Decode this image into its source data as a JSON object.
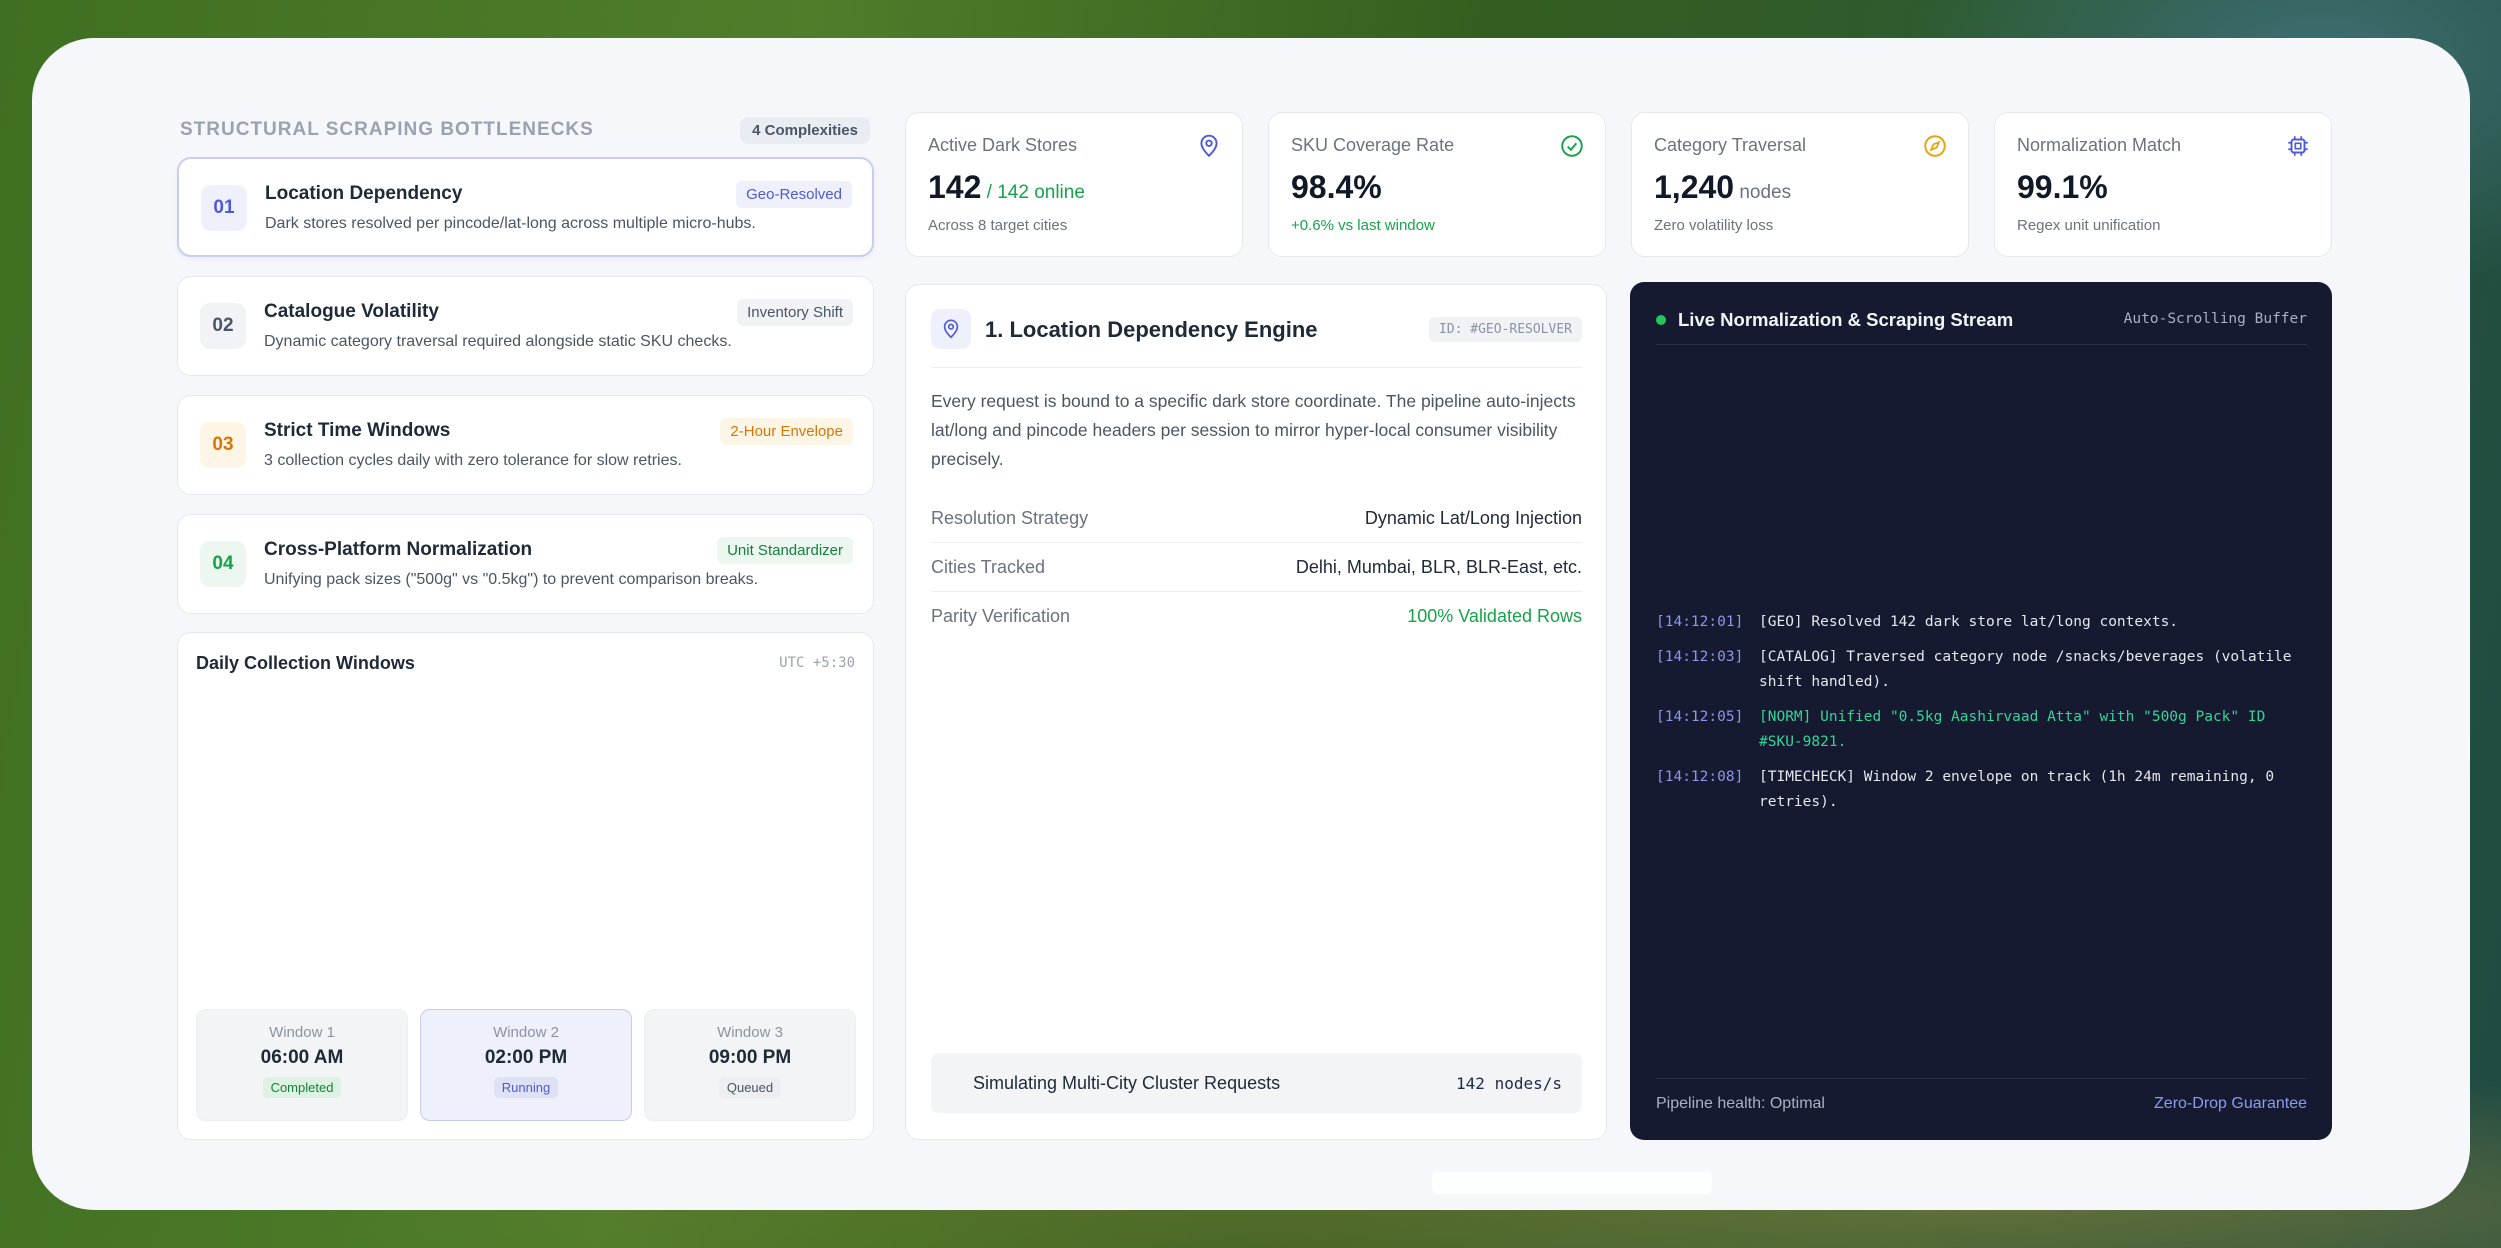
{
  "left": {
    "title": "STRUCTURAL SCRAPING BOTTLENECKS",
    "count": "4 Complexities",
    "items": [
      {
        "num": "01",
        "title": "Location Dependency",
        "desc": "Dark stores resolved per pincode/lat-long across multiple micro-hubs.",
        "tag": "Geo-Resolved"
      },
      {
        "num": "02",
        "title": "Catalogue Volatility",
        "desc": "Dynamic category traversal required alongside static SKU checks.",
        "tag": "Inventory Shift"
      },
      {
        "num": "03",
        "title": "Strict Time Windows",
        "desc": "3 collection cycles daily with zero tolerance for slow retries.",
        "tag": "2-Hour Envelope"
      },
      {
        "num": "04",
        "title": "Cross-Platform Normalization",
        "desc": "Unifying pack sizes (\"500g\" vs \"0.5kg\") to prevent comparison breaks.",
        "tag": "Unit Standardizer"
      }
    ]
  },
  "daily": {
    "title": "Daily Collection Windows",
    "timezone": "UTC +5:30",
    "windows": [
      {
        "label": "Window 1",
        "time": "06:00 AM",
        "status": "Completed"
      },
      {
        "label": "Window 2",
        "time": "02:00 PM",
        "status": "Running"
      },
      {
        "label": "Window 3",
        "time": "09:00 PM",
        "status": "Queued"
      }
    ]
  },
  "stats": [
    {
      "label": "Active Dark Stores",
      "value": "142",
      "sub": " / 142 online",
      "note": "Across 8 target cities",
      "icon": "map-pin-icon"
    },
    {
      "label": "SKU Coverage Rate",
      "value": "98.4%",
      "sub": "",
      "note": "+0.6% vs last window",
      "icon": "check-circle-icon"
    },
    {
      "label": "Category Traversal",
      "value": "1,240",
      "sub": " nodes",
      "note": "Zero volatility loss",
      "icon": "compass-icon"
    },
    {
      "label": "Normalization Match",
      "value": "99.1%",
      "sub": "",
      "note": "Regex unit unification",
      "icon": "chip-icon"
    }
  ],
  "engine": {
    "title": "1. Location Dependency Engine",
    "id": "ID: #GEO-RESOLVER",
    "desc": "Every request is bound to a specific dark store coordinate. The pipeline auto-injects lat/long and pincode headers per session to mirror hyper-local consumer visibility precisely.",
    "rows": [
      {
        "key": "Resolution Strategy",
        "value": "Dynamic Lat/Long Injection"
      },
      {
        "key": "Cities Tracked",
        "value": "Delhi, Mumbai, BLR, BLR-East, etc."
      },
      {
        "key": "Parity Verification",
        "value": "100% Validated Rows"
      }
    ],
    "sim_label": "Simulating Multi-City Cluster Requests",
    "sim_rate": "142 nodes/s"
  },
  "stream": {
    "title": "Live Normalization & Scraping Stream",
    "badge": "Auto-Scrolling Buffer",
    "logs": [
      {
        "ts": "[14:12:01]",
        "msg": "[GEO] Resolved 142 dark store lat/long contexts."
      },
      {
        "ts": "[14:12:03]",
        "msg": "[CATALOG] Traversed category node /snacks/beverages (volatile shift handled)."
      },
      {
        "ts": "[14:12:05]",
        "msg": "[NORM] Unified \"0.5kg Aashirvaad Atta\" with \"500g Pack\" ID #SKU-9821."
      },
      {
        "ts": "[14:12:08]",
        "msg": "[TIMECHECK] Window 2 envelope on track (1h 24m remaining, 0 retries)."
      }
    ],
    "footer_left": "Pipeline health: Optimal",
    "footer_right": "Zero-Drop Guarantee"
  },
  "colors": {
    "accent": "#4f5bd5",
    "success": "#16a34a",
    "warning": "#d97706",
    "stream_bg": "#151a30"
  }
}
